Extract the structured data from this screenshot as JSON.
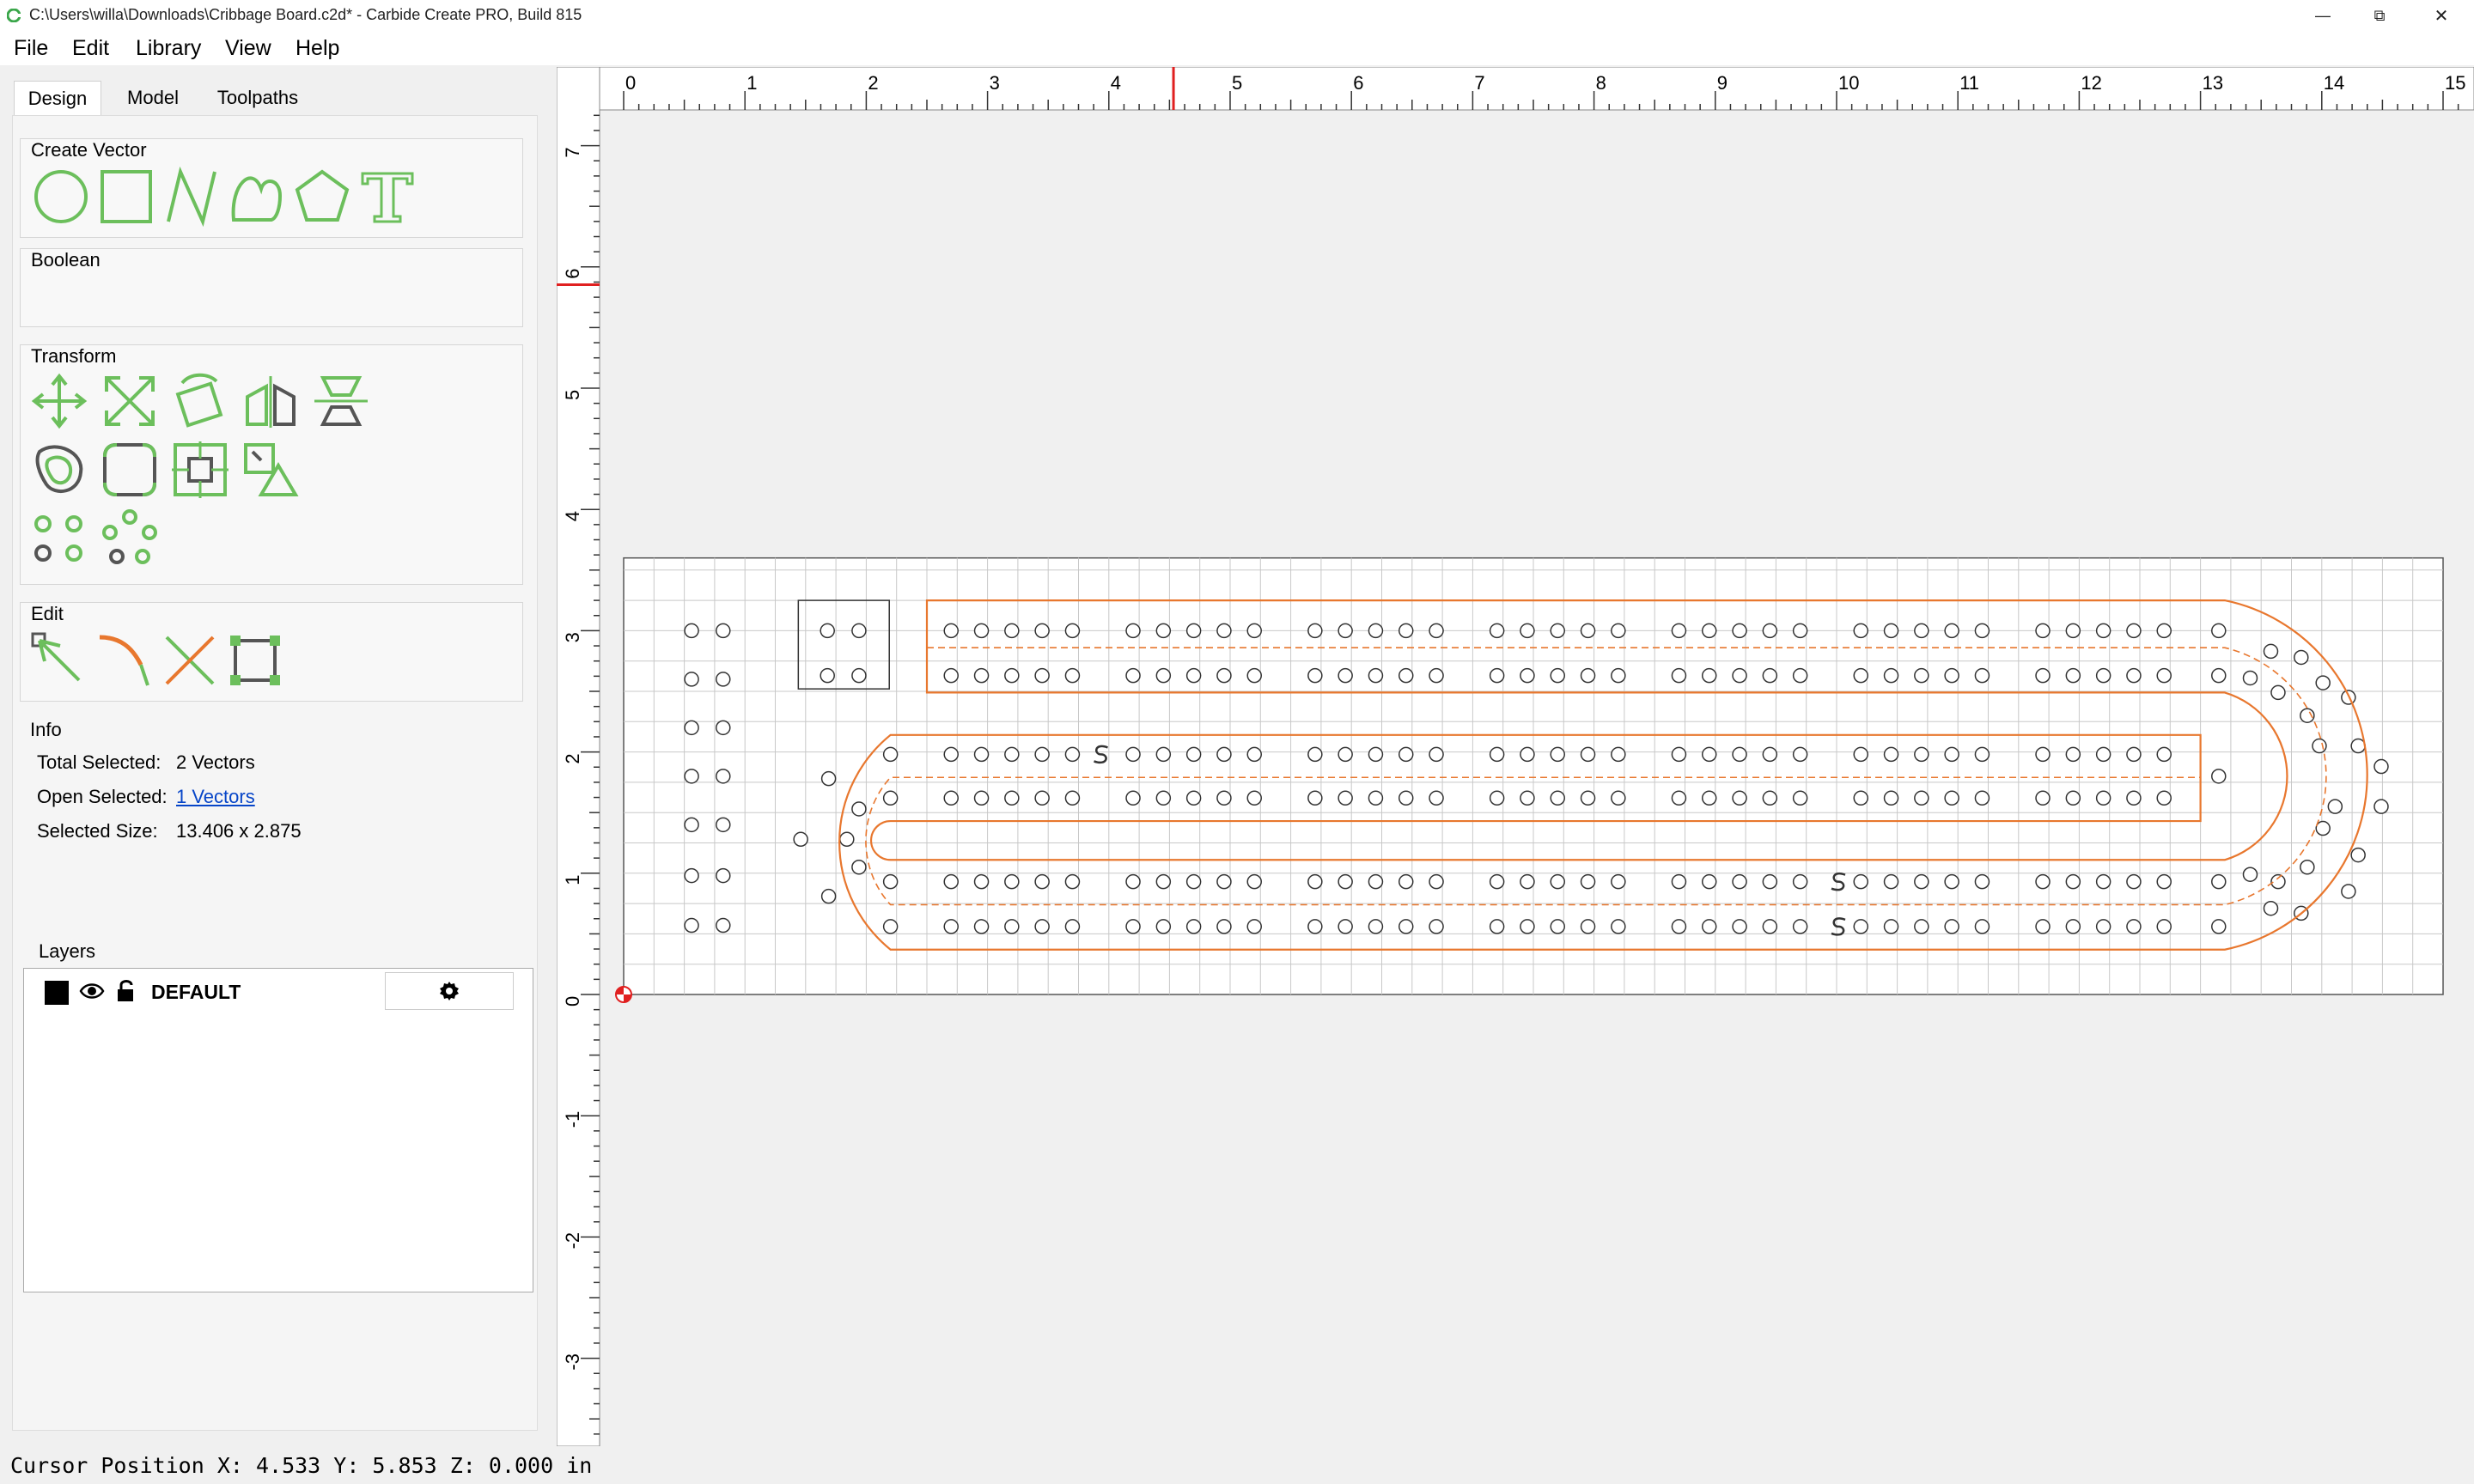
{
  "window": {
    "title": "C:\\Users\\willa\\Downloads\\Cribbage Board.c2d* - Carbide Create PRO, Build 815",
    "minimize_glyph": "—",
    "maximize_glyph": "⧉",
    "close_glyph": "✕"
  },
  "menu": {
    "file": "File",
    "edit": "Edit",
    "library": "Library",
    "view": "View",
    "help": "Help"
  },
  "tabs": {
    "design": "Design",
    "model": "Model",
    "toolpaths": "Toolpaths"
  },
  "sections": {
    "create_vector": "Create Vector",
    "boolean": "Boolean",
    "transform": "Transform",
    "edit": "Edit",
    "info": "Info",
    "layers": "Layers"
  },
  "info": {
    "total_selected_label": "Total Selected:",
    "total_selected_value": "2 Vectors",
    "open_selected_label": "Open Selected:",
    "open_selected_value": "1 Vectors",
    "selected_size_label": "Selected Size:",
    "selected_size_value": "13.406 x 2.875"
  },
  "layers": [
    {
      "name": "DEFAULT",
      "color": "#000000",
      "visible": true,
      "locked": false
    }
  ],
  "ruler": {
    "h_labels": [
      "0",
      "1",
      "2",
      "3",
      "4",
      "5",
      "6",
      "7",
      "8",
      "9",
      "10",
      "11",
      "12",
      "13",
      "14",
      "15"
    ],
    "v_labels": [
      "7",
      "6",
      "5",
      "4",
      "3",
      "2",
      "1",
      "0",
      "-1",
      "-2",
      "-3"
    ]
  },
  "cursor_marker": {
    "x": 4.533,
    "y": 5.853
  },
  "status": {
    "cursor_text": "Cursor Position X: 4.533 Y: 5.853 Z: 0.000 in"
  },
  "colors": {
    "accent_green": "#6cbf5c",
    "toolpath_orange": "#e8772e",
    "ruler_marker_red": "#e02020",
    "link_blue": "#0645c8"
  }
}
